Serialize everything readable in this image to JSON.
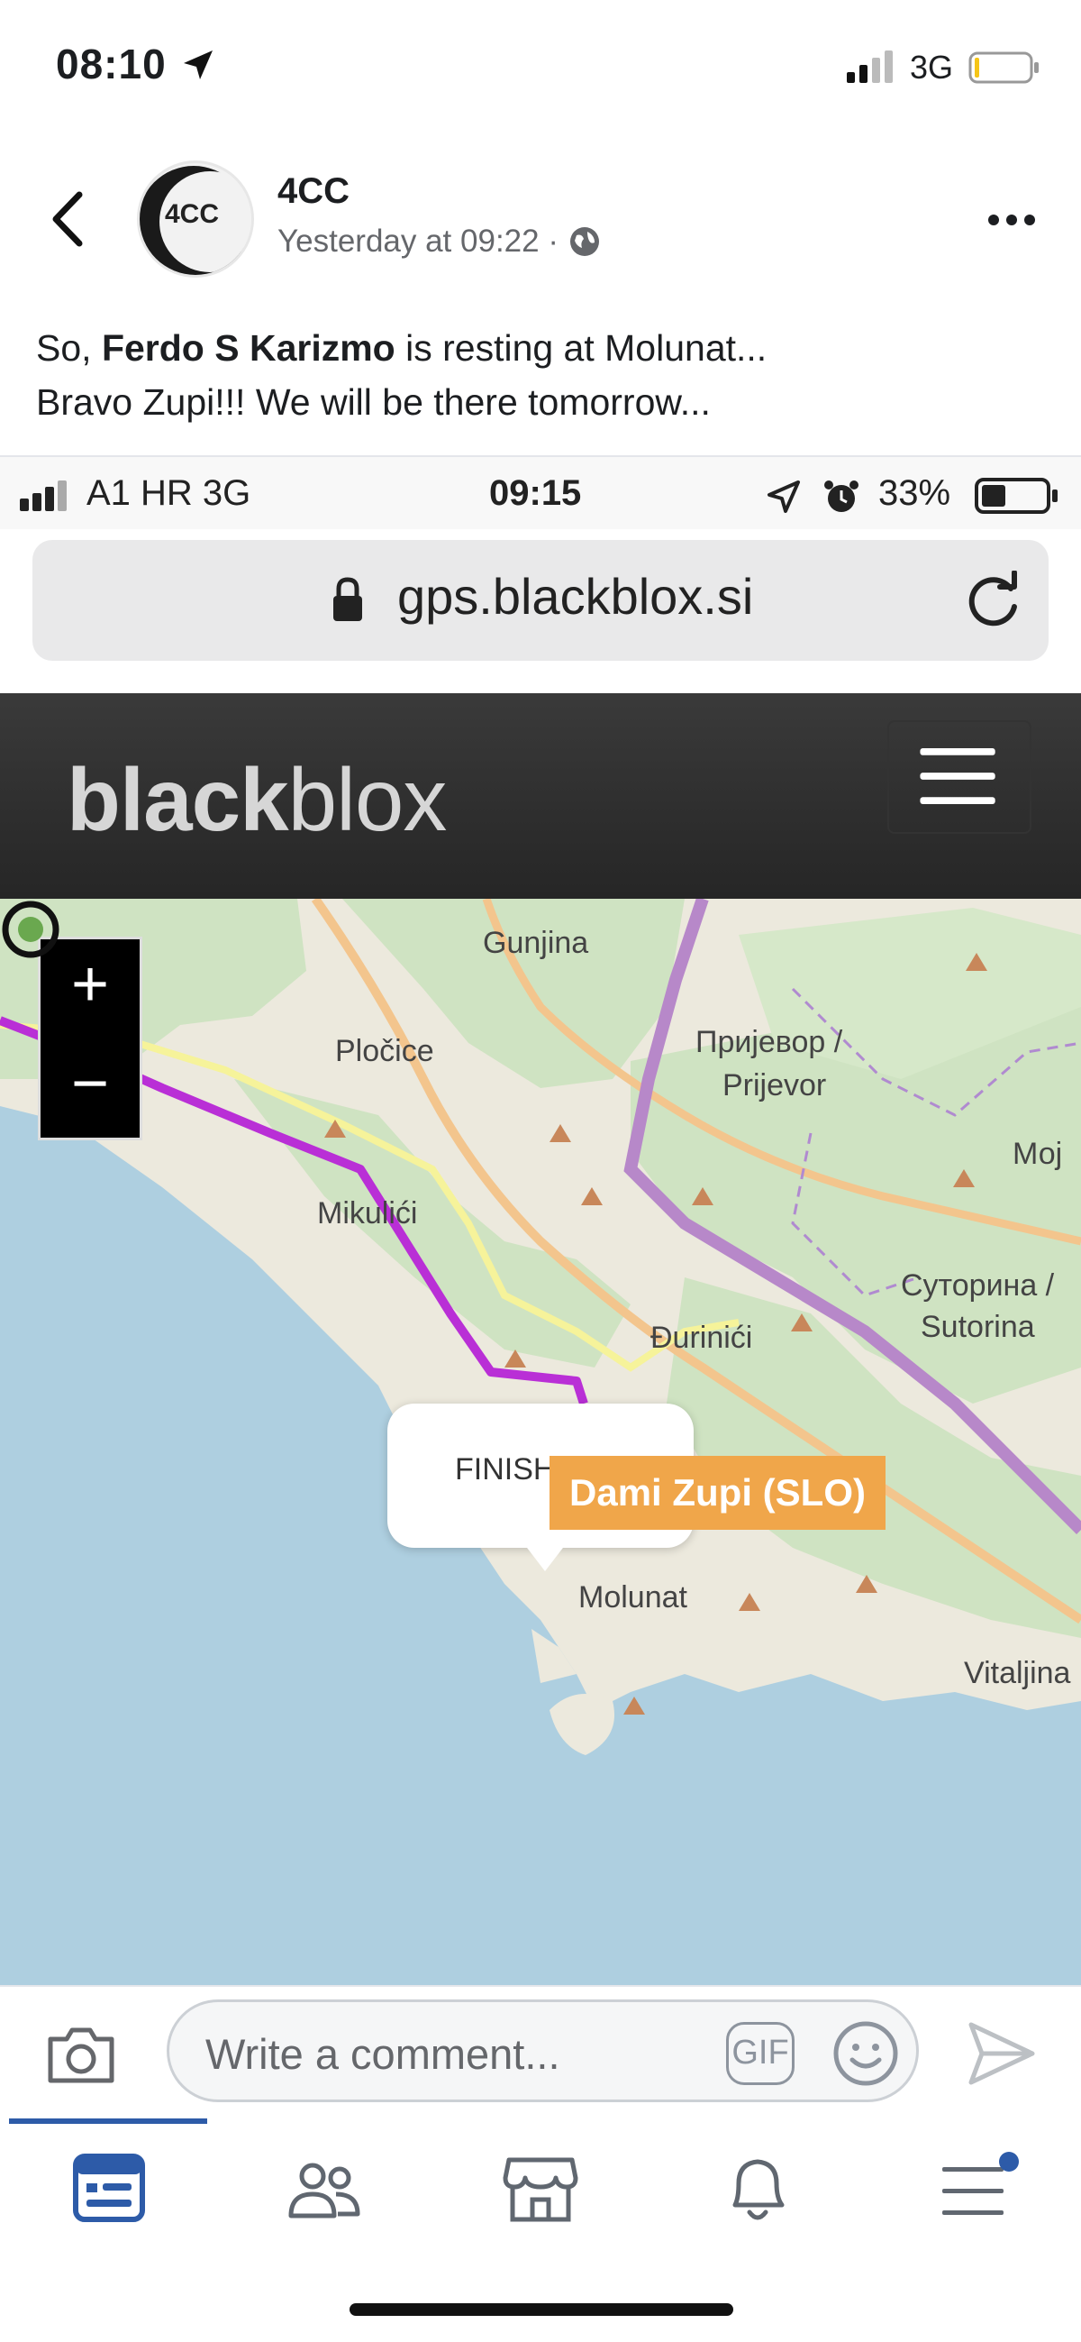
{
  "status_bar": {
    "time": "08:10",
    "network": "3G"
  },
  "post": {
    "page_name": "4CC",
    "avatar_text": "4CC",
    "meta": "Yesterday at 09:22 ·",
    "text_before": "So, ",
    "text_bold": "Ferdo S Karizmo",
    "text_after": " is resting at Molunat...",
    "text_line2": "Bravo Zupi!!! We will be there tomorrow..."
  },
  "screenshot": {
    "status": {
      "carrier": "A1 HR   3G",
      "time": "09:15",
      "battery": "33%"
    },
    "url": "gps.blackblox.si",
    "logo_bold": "black",
    "logo_light": "blox",
    "map": {
      "zoom_in": "+",
      "zoom_out": "−",
      "labels": {
        "gunjina": "Gunjina",
        "plocice": "Pločice",
        "prijevor": "Пријевор /",
        "prijevor2": "Prijevor",
        "mikulici": "Mikulići",
        "moj": "Мој",
        "sutorina": "Суторина /",
        "sutorina2": "Sutorina",
        "djurinici": "Đurinići",
        "molunat": "Molunat",
        "vitaljina": "Vitaljina"
      },
      "finish": "FINISH",
      "rider": "Dami Zupi (SLO)"
    }
  },
  "comment": {
    "placeholder": "Write a comment...",
    "gif": "GIF"
  },
  "icons": {
    "back": "chevron-left-icon",
    "more": "ellipsis-icon",
    "globe": "globe-icon",
    "camera": "camera-icon",
    "emoji": "smiley-icon",
    "send": "send-icon",
    "nav": [
      "news-feed-icon",
      "friends-icon",
      "marketplace-icon",
      "bell-icon",
      "menu-icon"
    ]
  },
  "colors": {
    "accent": "#2d5ba8",
    "route": "#b92fd6",
    "rider_tag": "#f0a64a"
  }
}
